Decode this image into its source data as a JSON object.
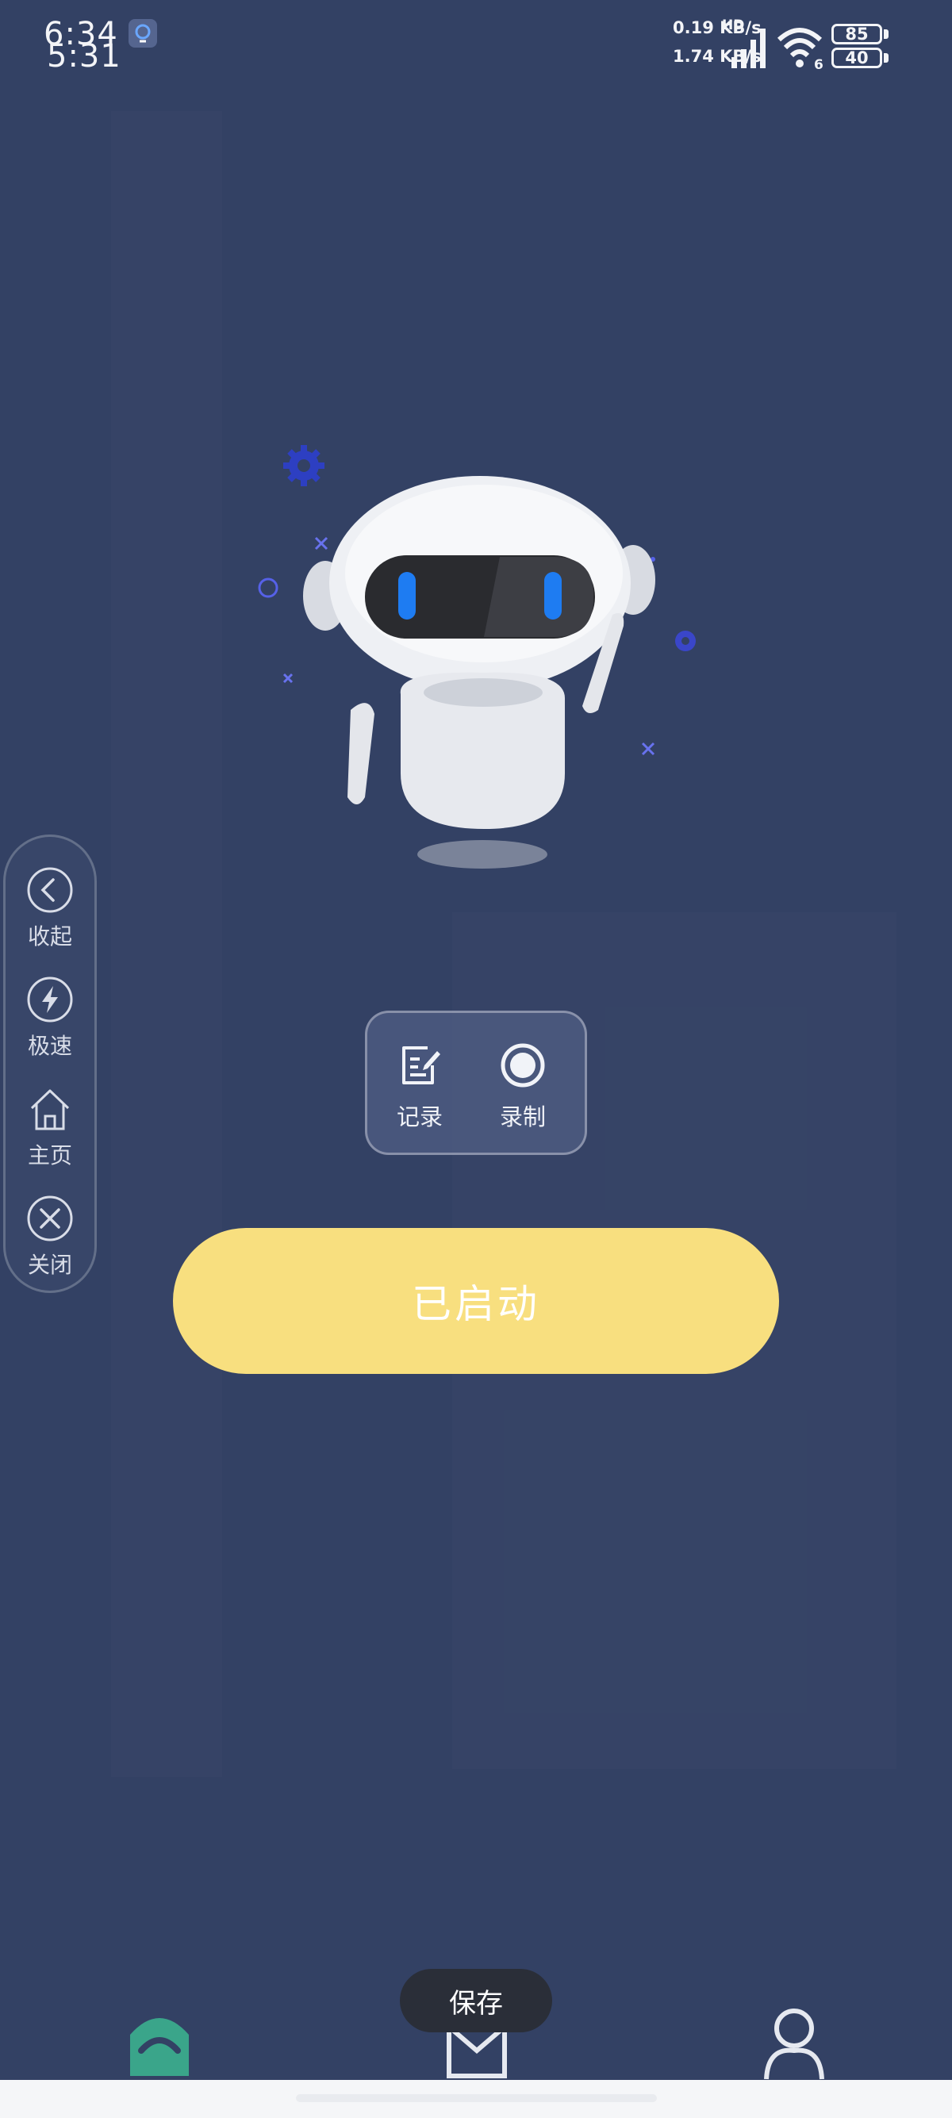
{
  "status_bar": {
    "time_primary": "6:34",
    "time_secondary": "5:31",
    "net_rate_top": "0.19 KB/s",
    "net_rate_bottom": "1.74 KB/s",
    "network_label": "HD",
    "wifi_badge": "6",
    "battery_top": "85",
    "battery_bottom": "40"
  },
  "side_panel": {
    "items": [
      {
        "label": "收起",
        "icon": "chevron-left-icon"
      },
      {
        "label": "极速",
        "icon": "lightning-icon"
      },
      {
        "label": "主页",
        "icon": "home-icon"
      },
      {
        "label": "关闭",
        "icon": "close-icon"
      }
    ]
  },
  "actions": {
    "record_log": {
      "label": "记录",
      "icon": "edit-note-icon"
    },
    "record_screen": {
      "label": "录制",
      "icon": "record-icon"
    }
  },
  "start_button": {
    "label": "已启动"
  },
  "toast": {
    "text": "保存"
  },
  "bottom_nav": {
    "tabs": [
      {
        "name": "home",
        "icon": "home-tab-icon",
        "active": true
      },
      {
        "name": "messages",
        "icon": "mail-tab-icon",
        "active": false
      },
      {
        "name": "profile",
        "icon": "profile-tab-icon",
        "active": false
      }
    ]
  },
  "colors": {
    "background": "#334164",
    "start_button": "#f8df7f",
    "active_tab": "#3aa58a",
    "robot_eye": "#1e7cf2"
  }
}
